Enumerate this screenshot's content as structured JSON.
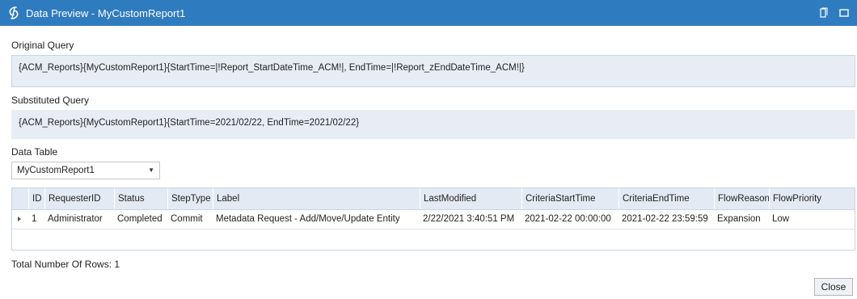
{
  "window": {
    "title": "Data Preview - MyCustomReport1",
    "logo_icon": "onestream-logo-icon",
    "buttons": [
      "restore-icon",
      "maximize-icon"
    ],
    "titlebar_color": "#2f7bbf"
  },
  "original_query": {
    "label": "Original Query",
    "value": "{ACM_Reports}{MyCustomReport1}{StartTime=|!Report_StartDateTime_ACM!|, EndTime=|!Report_zEndDateTime_ACM!|}"
  },
  "substituted_query": {
    "label": "Substituted Query",
    "value": "{ACM_Reports}{MyCustomReport1}{StartTime=2021/02/22, EndTime=2021/02/22}"
  },
  "data_table": {
    "label": "Data Table",
    "selected": "MyCustomReport1"
  },
  "grid": {
    "columns": [
      "ID",
      "RequesterID",
      "Status",
      "StepType",
      "Label",
      "LastModified",
      "CriteriaStartTime",
      "CriteriaEndTime",
      "FlowReason",
      "FlowPriority"
    ],
    "rows": [
      [
        "1",
        "Administrator",
        "Completed",
        "Commit",
        "Metadata Request - Add/Move/Update Entity",
        "2/22/2021 3:40:51 PM",
        "2021-02-22 00:00:00",
        "2021-02-22 23:59:59",
        "Expansion",
        "Low"
      ]
    ],
    "header_bg": "#e4eaf3"
  },
  "footer": {
    "total_rows": "Total Number Of Rows: 1",
    "close_label": "Close"
  }
}
